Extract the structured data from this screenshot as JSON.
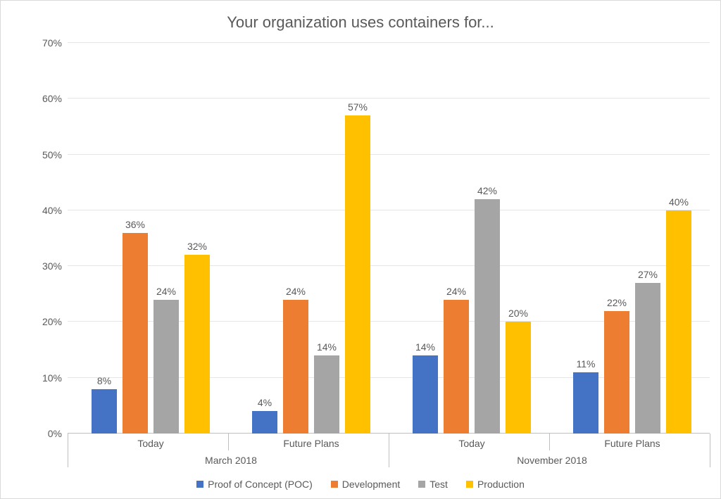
{
  "chart_data": {
    "type": "bar",
    "title": "Your organization uses containers for...",
    "ylabel": "",
    "xlabel": "",
    "ylim": [
      0,
      70
    ],
    "y_ticks": [
      0,
      10,
      20,
      30,
      40,
      50,
      60,
      70
    ],
    "y_tick_labels": [
      "0%",
      "10%",
      "20%",
      "30%",
      "40%",
      "50%",
      "60%",
      "70%"
    ],
    "categories": [
      "Today",
      "Future Plans",
      "Today",
      "Future Plans"
    ],
    "category_groups": [
      "March 2018",
      "November 2018"
    ],
    "series": [
      {
        "name": "Proof of Concept (POC)",
        "color": "#4472c4",
        "values": [
          8,
          4,
          14,
          11
        ]
      },
      {
        "name": "Development",
        "color": "#ed7d31",
        "values": [
          36,
          24,
          24,
          22
        ]
      },
      {
        "name": "Test",
        "color": "#a5a5a5",
        "values": [
          24,
          14,
          42,
          27
        ]
      },
      {
        "name": "Production",
        "color": "#ffc000",
        "values": [
          32,
          57,
          20,
          40
        ]
      }
    ],
    "value_labels": [
      [
        "8%",
        "4%",
        "14%",
        "11%"
      ],
      [
        "36%",
        "24%",
        "24%",
        "22%"
      ],
      [
        "24%",
        "14%",
        "42%",
        "27%"
      ],
      [
        "32%",
        "57%",
        "20%",
        "40%"
      ]
    ]
  }
}
